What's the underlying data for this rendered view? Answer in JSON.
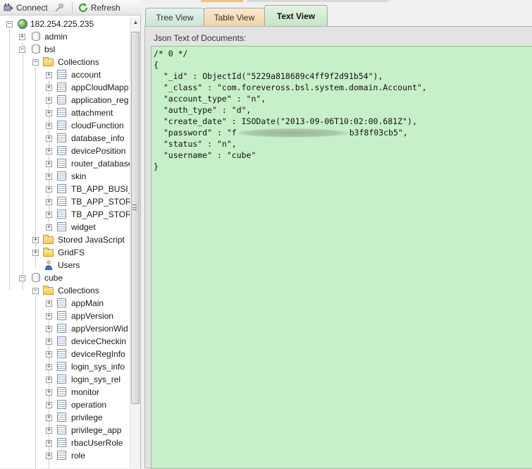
{
  "toolbar": {
    "connect_label": "Connect",
    "refresh_label": "Refresh"
  },
  "tree": {
    "server": "182.254.225.235",
    "databases": [
      {
        "name": "admin"
      },
      {
        "name": "bsl",
        "collections_label": "Collections",
        "collections": [
          "account",
          "appCloudMapp",
          "application_reg",
          "attachment",
          "cloudFunction",
          "database_info",
          "devicePosition",
          "router_database",
          "skin",
          "TB_APP_BUSI_T",
          "TB_APP_STORE",
          "TB_APP_STORE",
          "widget"
        ],
        "stored_js_label": "Stored JavaScript",
        "gridfs_label": "GridFS",
        "users_label": "Users"
      },
      {
        "name": "cube",
        "collections_label": "Collections",
        "collections": [
          "appMain",
          "appVersion",
          "appVersionWid",
          "deviceCheckin",
          "deviceRegInfo",
          "login_sys_info",
          "login_sys_rel",
          "monitor",
          "operation",
          "privilege",
          "privilege_app",
          "rbacUserRole",
          "role"
        ]
      }
    ]
  },
  "tabs": [
    {
      "label": "Tree View",
      "active": false
    },
    {
      "label": "Table View",
      "active": false
    },
    {
      "label": "Text View",
      "active": true
    }
  ],
  "panel": {
    "label": "Json Text of Documents:",
    "lines": [
      "/* 0 */",
      "{",
      "  \"_id\" : ObjectId(\"5229a818689c4ff9f2d91b54\"),",
      "  \"_class\" : \"com.foreveross.bsl.system.domain.Account\",",
      "  \"account_type\" : \"n\",",
      "  \"auth_type\" : \"d\",",
      "  \"create_date\" : ISODate(\"2013-09-06T10:02:00.681Z\"),",
      "  \"status\" : \"n\",",
      "  \"username\" : \"cube\"",
      "}"
    ],
    "password_prefix": "  \"password\" : \"f",
    "password_suffix": "b3f8f03cb5\","
  },
  "colors": {
    "json_bg": "#c8f0c8",
    "tab_tree": "#d4ece0",
    "tab_table": "#f4dcb4",
    "tab_text": "#cfe8cf"
  }
}
